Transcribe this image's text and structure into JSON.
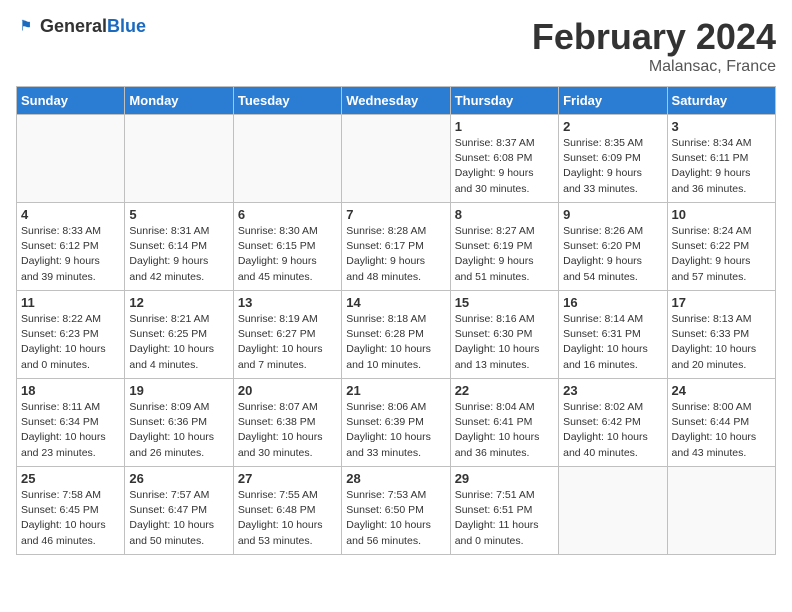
{
  "header": {
    "logo_general": "General",
    "logo_blue": "Blue",
    "month_year": "February 2024",
    "location": "Malansac, France"
  },
  "days_of_week": [
    "Sunday",
    "Monday",
    "Tuesday",
    "Wednesday",
    "Thursday",
    "Friday",
    "Saturday"
  ],
  "weeks": [
    [
      {
        "day": "",
        "info": ""
      },
      {
        "day": "",
        "info": ""
      },
      {
        "day": "",
        "info": ""
      },
      {
        "day": "",
        "info": ""
      },
      {
        "day": "1",
        "info": "Sunrise: 8:37 AM\nSunset: 6:08 PM\nDaylight: 9 hours\nand 30 minutes."
      },
      {
        "day": "2",
        "info": "Sunrise: 8:35 AM\nSunset: 6:09 PM\nDaylight: 9 hours\nand 33 minutes."
      },
      {
        "day": "3",
        "info": "Sunrise: 8:34 AM\nSunset: 6:11 PM\nDaylight: 9 hours\nand 36 minutes."
      }
    ],
    [
      {
        "day": "4",
        "info": "Sunrise: 8:33 AM\nSunset: 6:12 PM\nDaylight: 9 hours\nand 39 minutes."
      },
      {
        "day": "5",
        "info": "Sunrise: 8:31 AM\nSunset: 6:14 PM\nDaylight: 9 hours\nand 42 minutes."
      },
      {
        "day": "6",
        "info": "Sunrise: 8:30 AM\nSunset: 6:15 PM\nDaylight: 9 hours\nand 45 minutes."
      },
      {
        "day": "7",
        "info": "Sunrise: 8:28 AM\nSunset: 6:17 PM\nDaylight: 9 hours\nand 48 minutes."
      },
      {
        "day": "8",
        "info": "Sunrise: 8:27 AM\nSunset: 6:19 PM\nDaylight: 9 hours\nand 51 minutes."
      },
      {
        "day": "9",
        "info": "Sunrise: 8:26 AM\nSunset: 6:20 PM\nDaylight: 9 hours\nand 54 minutes."
      },
      {
        "day": "10",
        "info": "Sunrise: 8:24 AM\nSunset: 6:22 PM\nDaylight: 9 hours\nand 57 minutes."
      }
    ],
    [
      {
        "day": "11",
        "info": "Sunrise: 8:22 AM\nSunset: 6:23 PM\nDaylight: 10 hours\nand 0 minutes."
      },
      {
        "day": "12",
        "info": "Sunrise: 8:21 AM\nSunset: 6:25 PM\nDaylight: 10 hours\nand 4 minutes."
      },
      {
        "day": "13",
        "info": "Sunrise: 8:19 AM\nSunset: 6:27 PM\nDaylight: 10 hours\nand 7 minutes."
      },
      {
        "day": "14",
        "info": "Sunrise: 8:18 AM\nSunset: 6:28 PM\nDaylight: 10 hours\nand 10 minutes."
      },
      {
        "day": "15",
        "info": "Sunrise: 8:16 AM\nSunset: 6:30 PM\nDaylight: 10 hours\nand 13 minutes."
      },
      {
        "day": "16",
        "info": "Sunrise: 8:14 AM\nSunset: 6:31 PM\nDaylight: 10 hours\nand 16 minutes."
      },
      {
        "day": "17",
        "info": "Sunrise: 8:13 AM\nSunset: 6:33 PM\nDaylight: 10 hours\nand 20 minutes."
      }
    ],
    [
      {
        "day": "18",
        "info": "Sunrise: 8:11 AM\nSunset: 6:34 PM\nDaylight: 10 hours\nand 23 minutes."
      },
      {
        "day": "19",
        "info": "Sunrise: 8:09 AM\nSunset: 6:36 PM\nDaylight: 10 hours\nand 26 minutes."
      },
      {
        "day": "20",
        "info": "Sunrise: 8:07 AM\nSunset: 6:38 PM\nDaylight: 10 hours\nand 30 minutes."
      },
      {
        "day": "21",
        "info": "Sunrise: 8:06 AM\nSunset: 6:39 PM\nDaylight: 10 hours\nand 33 minutes."
      },
      {
        "day": "22",
        "info": "Sunrise: 8:04 AM\nSunset: 6:41 PM\nDaylight: 10 hours\nand 36 minutes."
      },
      {
        "day": "23",
        "info": "Sunrise: 8:02 AM\nSunset: 6:42 PM\nDaylight: 10 hours\nand 40 minutes."
      },
      {
        "day": "24",
        "info": "Sunrise: 8:00 AM\nSunset: 6:44 PM\nDaylight: 10 hours\nand 43 minutes."
      }
    ],
    [
      {
        "day": "25",
        "info": "Sunrise: 7:58 AM\nSunset: 6:45 PM\nDaylight: 10 hours\nand 46 minutes."
      },
      {
        "day": "26",
        "info": "Sunrise: 7:57 AM\nSunset: 6:47 PM\nDaylight: 10 hours\nand 50 minutes."
      },
      {
        "day": "27",
        "info": "Sunrise: 7:55 AM\nSunset: 6:48 PM\nDaylight: 10 hours\nand 53 minutes."
      },
      {
        "day": "28",
        "info": "Sunrise: 7:53 AM\nSunset: 6:50 PM\nDaylight: 10 hours\nand 56 minutes."
      },
      {
        "day": "29",
        "info": "Sunrise: 7:51 AM\nSunset: 6:51 PM\nDaylight: 11 hours\nand 0 minutes."
      },
      {
        "day": "",
        "info": ""
      },
      {
        "day": "",
        "info": ""
      }
    ]
  ]
}
